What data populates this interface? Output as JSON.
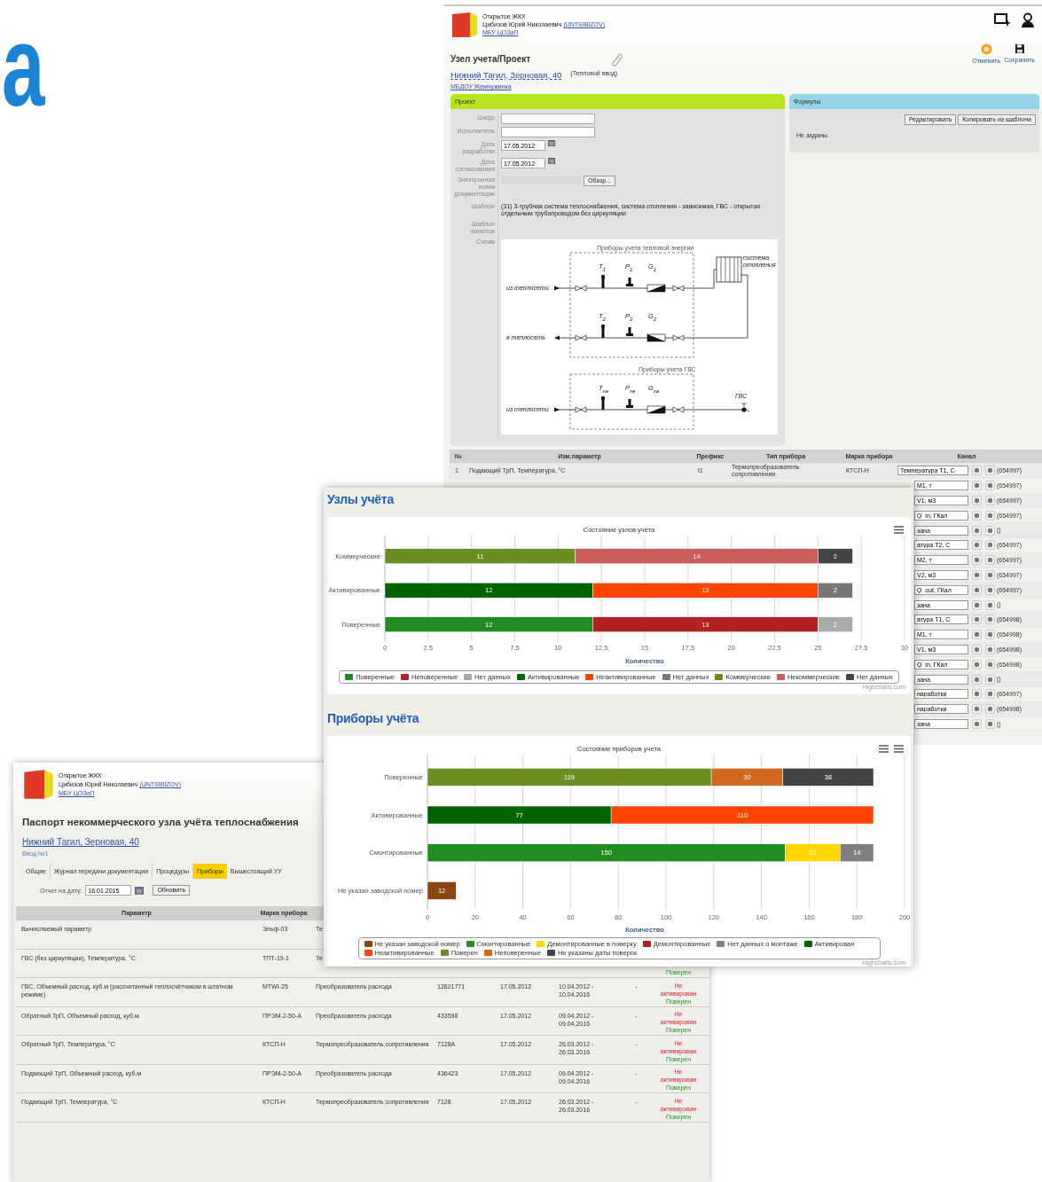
{
  "slide_title": "а",
  "project_window": {
    "org": "Открытое ЖКХ",
    "user": "Цибизов Юрий Николаевич",
    "login": "(UNTSIBIZOV)",
    "dept": "МБУ ЦОЗиП",
    "title": "Узел учета/Проект",
    "actions": [
      {
        "label": "Отменить",
        "kind": "cancel"
      },
      {
        "label": "Сохранить",
        "kind": "save"
      }
    ],
    "address": "Нижний Тагил, Зерновая, 40",
    "address_note": "(Тепловой ввод)",
    "organization": "МБДОУ Жемчужинка",
    "project_panel": {
      "title": "Проект",
      "fields": [
        {
          "label": "Шифр",
          "kind": "text"
        },
        {
          "label": "Исполнитель",
          "kind": "text"
        },
        {
          "label": "Дата разработки",
          "kind": "date",
          "value": "17.05.2012"
        },
        {
          "label": "Дата согласования",
          "kind": "date",
          "value": "17.05.2012"
        },
        {
          "label": "Электронная копия документации",
          "kind": "file",
          "button": "Обзор..."
        },
        {
          "label": "Шаблон",
          "kind": "static",
          "value": "(31) 3-трубная система теплоснабжения, система отопления - зависимая, ГВС - открытая отдельным трубопроводом без циркуляции"
        },
        {
          "label": "Шаблон каналов",
          "kind": "static"
        },
        {
          "label": "Схема",
          "kind": "scheme"
        }
      ]
    },
    "scheme": {
      "groups": [
        "Приборы учета тепловой энергии",
        "Приборы учета ГВС"
      ],
      "lines": [
        {
          "label": "из теплосети",
          "outgoing": false,
          "sensors": [
            "T$_{1}$",
            "P$_{1}$",
            "G$_{1}$"
          ]
        },
        {
          "label": "в теплосеть",
          "outgoing": true,
          "sensors": [
            "T$_{2}$",
            "P$_{2}$",
            "G$_{2}$"
          ]
        },
        {
          "label": "из теплосети",
          "outgoing": false,
          "sensors": [
            "T$_{гв}$",
            "P$_{гв}$",
            "G$_{гв}$"
          ]
        }
      ],
      "heating_system": "система отопления",
      "hot_water": "ГВС"
    },
    "formulas_panel": {
      "title": "Формулы",
      "buttons": [
        "Редактировать",
        "Копировать из шаблона"
      ],
      "text": "Не заданы."
    },
    "table": {
      "columns": [
        "№",
        "Изм.параметр",
        "Префикс",
        "Тип прибора",
        "Марка прибора",
        "Канал"
      ],
      "rows": [
        {
          "number": "1",
          "parameter": "Подающий ТрП, Температура, °С",
          "prefix": "t1",
          "device_type": "Термопреобразователь сопротивления",
          "device_brand": "КТСП-Н",
          "channel": "Температура Т1, С",
          "code": "(654997)"
        },
        {
          "channel": "М1, т",
          "code": "(654997)"
        },
        {
          "channel": "V1, м3",
          "code": "(654997)"
        },
        {
          "channel": "Q_in, ГКал",
          "code": "(654997)"
        },
        {
          "channel": "зана",
          "code": "()"
        },
        {
          "channel": "атура Т2, С",
          "code": "(654997)"
        },
        {
          "channel": "М2, т",
          "code": "(654997)"
        },
        {
          "channel": "V2, м3",
          "code": "(654997)"
        },
        {
          "channel": "Q_out, ГКал",
          "code": "(654997)"
        },
        {
          "channel": "зана",
          "code": "()"
        },
        {
          "channel": "атура Т1, С",
          "code": "(654998)"
        },
        {
          "channel": "М1, т",
          "code": "(654998)"
        },
        {
          "channel": "V1, м3",
          "code": "(654998)"
        },
        {
          "channel": "Q_in, ГКал",
          "code": "(654998)"
        },
        {
          "channel": "зана",
          "code": "()"
        },
        {
          "channel": "наработки",
          "code": "(654997)"
        },
        {
          "channel": "наработки",
          "code": "(654998)"
        },
        {
          "channel": "зана",
          "code": "()"
        }
      ]
    }
  },
  "charts_window": {
    "sections": [
      {
        "heading": "Узлы учёта",
        "menus": [
          {
            "kind": "menu"
          }
        ],
        "credit": "Highcharts.com",
        "chart_data": {
          "type": "bar",
          "orientation": "horizontal",
          "stacked": true,
          "grid": true,
          "data_labels": true,
          "title": "Состояние узлов учета",
          "xlabel": "Количество",
          "categories": [
            "Коммерческие",
            "Активированные",
            "Поверенные"
          ],
          "xlim": [
            0,
            30
          ],
          "xticks": [
            0,
            2.5,
            5,
            7.5,
            10,
            12.5,
            15,
            17.5,
            20,
            22.5,
            25,
            27.5,
            30
          ],
          "series": [
            {
              "name": "Поверенные",
              "color": "#228b22",
              "values": [
                null,
                null,
                12
              ]
            },
            {
              "name": "Неповеренные",
              "color": "#b22222",
              "values": [
                null,
                null,
                13
              ]
            },
            {
              "name": "Нет данных",
              "color": "#aaaaaa",
              "values": [
                null,
                null,
                2
              ]
            },
            {
              "name": "Активированные",
              "color": "#006400",
              "values": [
                null,
                12,
                null
              ]
            },
            {
              "name": "Неактивированные",
              "color": "#ff4500",
              "values": [
                null,
                13,
                null
              ]
            },
            {
              "name": "Нет данных",
              "color": "#777777",
              "values": [
                null,
                2,
                null
              ]
            },
            {
              "name": "Коммерческие",
              "color": "#6b8e23",
              "values": [
                11,
                null,
                null
              ]
            },
            {
              "name": "Некоммерческие",
              "color": "#cd5c5c",
              "values": [
                14,
                null,
                null
              ]
            },
            {
              "name": "Нет данных",
              "color": "#444444",
              "values": [
                2,
                null,
                null
              ]
            }
          ]
        }
      },
      {
        "heading": "Приборы учёта",
        "menus": [
          {
            "kind": "menu"
          },
          {
            "kind": "menu"
          }
        ],
        "credit": "Highcharts.com",
        "chart_data": {
          "type": "bar",
          "orientation": "horizontal",
          "stacked": true,
          "grid": true,
          "data_labels": true,
          "title": "Состояние приборов учета",
          "xlabel": "Количество",
          "categories": [
            "Поверенные",
            "Активированные",
            "Смонтированные",
            "Не указан заводской номер"
          ],
          "xlim": [
            0,
            200
          ],
          "xticks": [
            0,
            20,
            40,
            60,
            80,
            100,
            120,
            140,
            160,
            180,
            200
          ],
          "series": [
            {
              "name": "Не указан заводской номер",
              "color": "#8b4513",
              "values": [
                null,
                null,
                null,
                12
              ]
            },
            {
              "name": "Смонтированные",
              "color": "#228b22",
              "values": [
                null,
                null,
                150,
                null
              ]
            },
            {
              "name": "Демонтированные в поверку",
              "color": "#ffd700",
              "values": [
                null,
                null,
                23,
                null
              ]
            },
            {
              "name": "Демонтированные",
              "color": "#b22222",
              "values": [
                null,
                null,
                null,
                null
              ]
            },
            {
              "name": "Нет данных о монтаже",
              "color": "#808080",
              "values": [
                null,
                null,
                14,
                null
              ]
            },
            {
              "name": "Активирован",
              "color": "#006400",
              "values": [
                null,
                77,
                null,
                null
              ]
            },
            {
              "name": "Неактивированные",
              "color": "#ff4500",
              "values": [
                null,
                110,
                null,
                null
              ]
            },
            {
              "name": "Поверен",
              "color": "#6b8e23",
              "values": [
                119,
                null,
                null,
                null
              ]
            },
            {
              "name": "Неповеренные",
              "color": "#d2691e",
              "values": [
                30,
                null,
                null,
                null
              ]
            },
            {
              "name": "Не указаны даты поверок",
              "color": "#444444",
              "values": [
                38,
                null,
                null,
                null
              ]
            }
          ]
        }
      }
    ]
  },
  "passport_window": {
    "org": "Открытое ЖКХ",
    "user": "Цибизов Юрий Николаевич",
    "login": "(UNTSIBIZOV)",
    "dept": "МБУ ЦОЗиП",
    "title": "Паспорт некоммерческого узла учёта теплоснабжения",
    "address": "Нижний Тагил, Зерновая, 40",
    "input_name": "Ввод №1",
    "tabs": [
      {
        "label": "Общие",
        "selected": false
      },
      {
        "label": "Журнал передачи документации",
        "selected": false
      },
      {
        "label": "Процедуры",
        "selected": false
      },
      {
        "label": "Приборы",
        "selected": true
      },
      {
        "label": "Вышестоящий УУ",
        "selected": false
      }
    ],
    "report_date_label": "Отчет на дату:",
    "report_date": "16.01.2015",
    "refresh_button": "Обновить",
    "table": {
      "columns": [
        "Параметр",
        "Марка прибора"
      ],
      "rows": [
        {
          "parameter": "Вычисляемый параметр",
          "brand": "Эльф-03",
          "device_type": "Те"
        },
        {
          "parameter": "ГВС (без циркуляции), Температура, °С",
          "brand": "ТПТ-19-1",
          "device_type": "Те",
          "status": [
            {
              "text": "Поверен",
              "ok": true
            }
          ]
        },
        {
          "parameter": "ГВС, Объемный расход, куб.м (рассчитанный теплосчётчиком в штатном режиме)",
          "brand": "MTWI-25",
          "device_type": "Преобразователь расхода",
          "serial": "12821771",
          "install_date": "17.05.2012",
          "verification": "10.04.2012 - 10.04.2016",
          "note": "-",
          "status": [
            {
              "text": "Не активирован",
              "ok": false
            },
            {
              "text": "Поверен",
              "ok": true
            }
          ]
        },
        {
          "parameter": "Обратный ТрП, Объемный расход, куб.м",
          "brand": "ПРЭМ-2-50-А",
          "device_type": "Преобразователь расхода",
          "serial": "433598",
          "install_date": "17.05.2012",
          "verification": "09.04.2012 - 09.04.2016",
          "note": "-",
          "status": [
            {
              "text": "Не активирован",
              "ok": false
            },
            {
              "text": "Поверен",
              "ok": true
            }
          ]
        },
        {
          "parameter": "Обратный ТрП, Температура, °С",
          "brand": "КТСП-Н",
          "device_type": "Термопреобразователь сопротивления",
          "serial": "7128А",
          "install_date": "17.05.2012",
          "verification": "26.03.2012 - 26.03.2016",
          "note": "-",
          "status": [
            {
              "text": "Не активирован",
              "ok": false
            },
            {
              "text": "Поверен",
              "ok": true
            }
          ]
        },
        {
          "parameter": "Подающий ТрП, Объемный расход, куб.м",
          "brand": "ПРЭМ-2-50-А",
          "device_type": "Преобразователь расхода",
          "serial": "436423",
          "install_date": "17.05.2012",
          "verification": "09.04.2012 - 09.04.2016",
          "note": "-",
          "status": [
            {
              "text": "Не активирован",
              "ok": false
            },
            {
              "text": "Поверен",
              "ok": true
            }
          ]
        },
        {
          "parameter": "Подающий ТрП, Температура, °С",
          "brand": "КТСП-Н",
          "device_type": "Термопреобразователь сопротивления",
          "serial": "7128",
          "install_date": "17.05.2012",
          "verification": "26.03.2012 - 26.03.2016",
          "note": "-",
          "status": [
            {
              "text": "Не активирован",
              "ok": false
            },
            {
              "text": "Поверен",
              "ok": true
            }
          ]
        }
      ]
    }
  }
}
